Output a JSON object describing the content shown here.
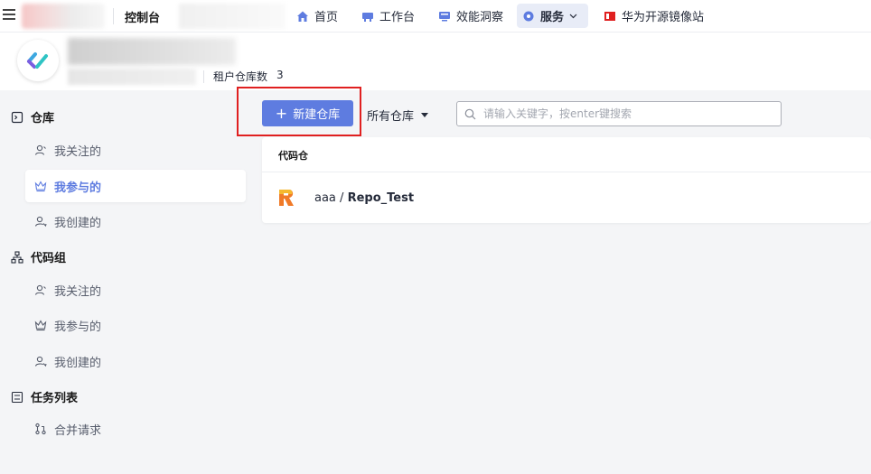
{
  "topbar": {
    "console_label": "控制台",
    "nav": [
      {
        "label": "首页",
        "icon": "home-icon"
      },
      {
        "label": "工作台",
        "icon": "workbench-icon"
      },
      {
        "label": "效能洞察",
        "icon": "insight-icon"
      },
      {
        "label": "服务",
        "icon": "service-icon"
      },
      {
        "label": "华为开源镜像站",
        "icon": "mirror-icon"
      }
    ]
  },
  "header": {
    "repo_count_label": "租户仓库数",
    "repo_count": "3"
  },
  "sidebar": {
    "sections": [
      {
        "title": "仓库",
        "items": [
          "我关注的",
          "我参与的",
          "我创建的"
        ]
      },
      {
        "title": "代码组",
        "items": [
          "我关注的",
          "我参与的",
          "我创建的"
        ]
      },
      {
        "title": "任务列表",
        "items": [
          "合并请求"
        ]
      }
    ],
    "active_item": "我参与的"
  },
  "toolbar": {
    "new_repo_label": "新建仓库",
    "filter_label": "所有仓库",
    "search_placeholder": "请输入关键字，按enter键搜索"
  },
  "list": {
    "header": "代码仓",
    "repos": [
      {
        "owner": "aaa",
        "name": "Repo_Test"
      }
    ]
  },
  "colors": {
    "accent": "#5e7ce0",
    "highlight_box": "#e02020"
  }
}
